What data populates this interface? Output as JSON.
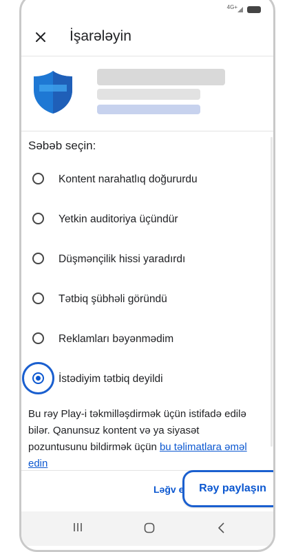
{
  "status_bar": {
    "network": "4G+"
  },
  "header": {
    "title": "İşarələyin",
    "close_icon": "close-icon"
  },
  "reason_prompt": "Səbəb seçin:",
  "options": [
    {
      "label": "Kontent narahatlıq doğururdu",
      "selected": false
    },
    {
      "label": "Yetkin auditoriya üçündür",
      "selected": false
    },
    {
      "label": "Düşmənçilik hissi yaradırdı",
      "selected": false
    },
    {
      "label": "Tətbiq şübhəli göründü",
      "selected": false
    },
    {
      "label": "Reklamları bəyənmədim",
      "selected": false
    },
    {
      "label": "İstədiyim tətbiq deyildi",
      "selected": true
    }
  ],
  "disclaimer": {
    "text": "Bu rəy Play-i təkmilləşdirmək üçün istifadə edilə bilər. Qanunsuz kontent və ya siyasət pozuntusunu bildirmək üçün ",
    "link": "bu təlimatlara əməl edin"
  },
  "footer": {
    "cancel_label": "Ləğv e",
    "submit_label": "Rəy paylaşın"
  },
  "colors": {
    "accent": "#0b57d0",
    "highlight": "#1a5fcf"
  },
  "nav": {
    "recent": "recent-apps-icon",
    "home": "home-icon",
    "back": "back-icon"
  }
}
